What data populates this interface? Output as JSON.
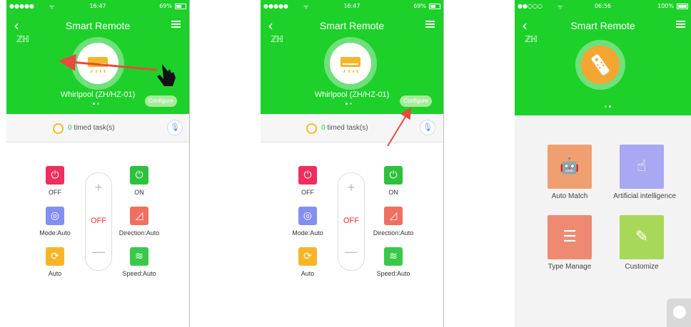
{
  "colors": {
    "green": "#1dd12a",
    "off_red": "#ee2e2e",
    "arrow_red": "#e84b3c"
  },
  "screens": [
    {
      "status": {
        "signal": "●●●●●",
        "wifi": "ᯤ",
        "time": "16:47",
        "battery": "69%"
      },
      "nav": {
        "back_icon": "chevron-left-icon",
        "title": "Smart Remote",
        "menu_icon": "list-icon"
      },
      "device_name": "Whirlpool",
      "device_code": "(ZH/HZ-01)",
      "configure_label": "Configure",
      "timer": {
        "count": "0",
        "text": "timed task(s)"
      },
      "controls": {
        "off_label": "OFF",
        "on_label": "ON",
        "mode_label": "Mode:Auto",
        "direction_label": "Direction:Auto",
        "auto_label": "Auto",
        "speed_label": "Speed:Auto",
        "temp_value": "OFF",
        "plus": "+",
        "minus": "—"
      }
    },
    {
      "status": {
        "signal": "●●●●●",
        "wifi": "ᯤ",
        "time": "16:47",
        "battery": "69%"
      },
      "nav": {
        "back_icon": "chevron-left-icon",
        "title": "Smart Remote",
        "menu_icon": "list-icon"
      },
      "device_name": "Whirlpool",
      "device_code": "(ZH/HZ-01)",
      "configure_label": "Configure",
      "timer": {
        "count": "0",
        "text": "timed task(s)"
      },
      "controls": {
        "off_label": "OFF",
        "on_label": "ON",
        "mode_label": "Mode:Auto",
        "direction_label": "Direction:Auto",
        "auto_label": "Auto",
        "speed_label": "Speed:Auto",
        "temp_value": "OFF",
        "plus": "+",
        "minus": "—"
      }
    },
    {
      "status": {
        "signal": "●●○○○",
        "wifi": "ᯤ",
        "time": "06:56",
        "battery": "100%"
      },
      "nav": {
        "back_icon": "chevron-left-icon",
        "title": "Smart Remote",
        "menu_icon": "list-icon"
      },
      "options": [
        {
          "label": "Auto Match",
          "icon": "android-icon",
          "color": "#f0a070"
        },
        {
          "label": "Artificial intelligence",
          "icon": "touch-hand-icon",
          "color": "#a9a8f2"
        },
        {
          "label": "Type Manage",
          "icon": "list-circle-icon",
          "color": "#ef8a72"
        },
        {
          "label": "Customize",
          "icon": "edit-icon",
          "color": "#a8d85a"
        }
      ]
    }
  ]
}
